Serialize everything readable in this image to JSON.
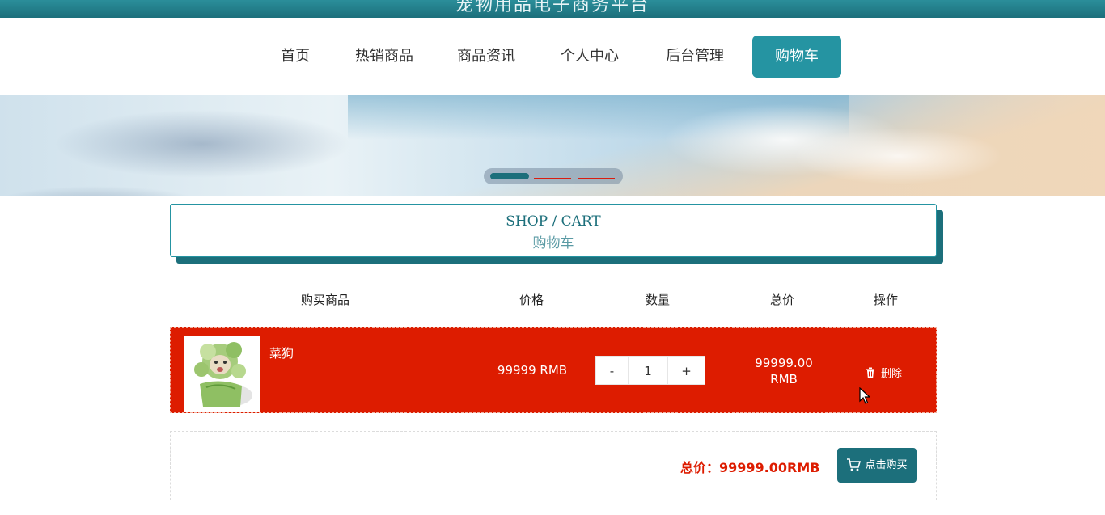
{
  "header": {
    "site_title": "宠物用品电子商务平台"
  },
  "nav": {
    "items": [
      {
        "label": "首页"
      },
      {
        "label": "热销商品"
      },
      {
        "label": "商品资讯"
      },
      {
        "label": "个人中心"
      },
      {
        "label": "后台管理"
      },
      {
        "label": "购物车",
        "active": true
      }
    ]
  },
  "banner": {
    "slides": 3,
    "active_index": 0
  },
  "section": {
    "title_en": "SHOP / CART",
    "title_cn": "购物车"
  },
  "table": {
    "headers": [
      "购买商品",
      "价格",
      "数量",
      "总价",
      "操作"
    ],
    "rows": [
      {
        "name": "菜狗",
        "price": "99999 RMB",
        "quantity": "1",
        "total_line1": "99999.00",
        "total_line2": "RMB",
        "delete_label": "删除"
      }
    ]
  },
  "qty_controls": {
    "minus": "-",
    "plus": "+"
  },
  "summary": {
    "total_text": "总价：99999.00RMB",
    "buy_label": "点击购买"
  },
  "colors": {
    "accent": "#2594a2",
    "dark_teal": "#1c6f7b",
    "row_red": "#dd1c00"
  },
  "icons": {
    "delete": "trash-icon",
    "buy": "cart-icon"
  }
}
